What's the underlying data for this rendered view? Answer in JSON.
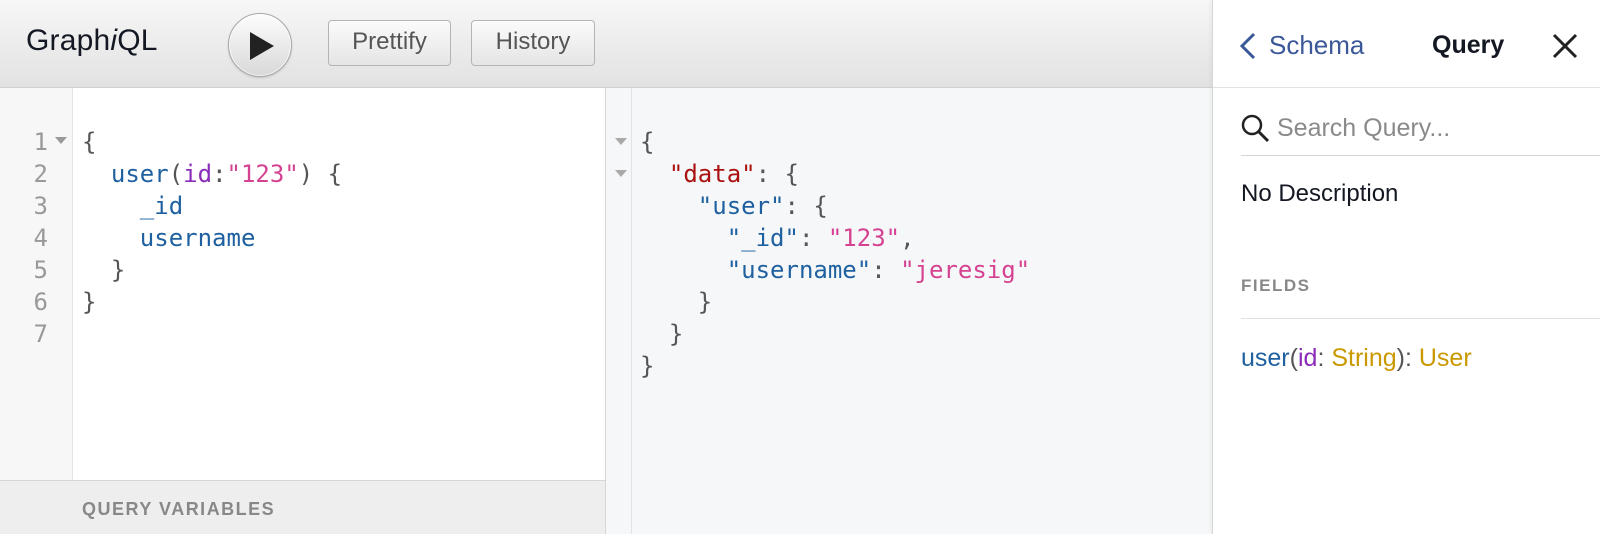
{
  "app": {
    "logo_text": "Graph",
    "logo_italic": "i",
    "logo_suffix": "QL"
  },
  "toolbar": {
    "run_icon": "play-icon",
    "prettify_label": "Prettify",
    "history_label": "History"
  },
  "query_editor": {
    "line_numbers": [
      "1",
      "2",
      "3",
      "4",
      "5",
      "6",
      "7"
    ],
    "lines": [
      [
        {
          "t": "{",
          "c": "punc"
        }
      ],
      [
        {
          "t": "  ",
          "c": "punc"
        },
        {
          "t": "user",
          "c": "field"
        },
        {
          "t": "(",
          "c": "punc"
        },
        {
          "t": "id",
          "c": "arg"
        },
        {
          "t": ":",
          "c": "punc"
        },
        {
          "t": "\"123\"",
          "c": "str"
        },
        {
          "t": ") {",
          "c": "punc"
        }
      ],
      [
        {
          "t": "    ",
          "c": "punc"
        },
        {
          "t": "_id",
          "c": "field"
        }
      ],
      [
        {
          "t": "    ",
          "c": "punc"
        },
        {
          "t": "username",
          "c": "field"
        }
      ],
      [
        {
          "t": "  }",
          "c": "punc"
        }
      ],
      [
        {
          "t": "}",
          "c": "punc"
        }
      ],
      [
        {
          "t": "",
          "c": "punc"
        }
      ]
    ],
    "variables_title": "QUERY VARIABLES"
  },
  "result": {
    "lines": [
      [
        {
          "t": "{",
          "c": "punc"
        }
      ],
      [
        {
          "t": "  ",
          "c": "punc"
        },
        {
          "t": "\"data\"",
          "c": "key"
        },
        {
          "t": ": {",
          "c": "punc"
        }
      ],
      [
        {
          "t": "    ",
          "c": "punc"
        },
        {
          "t": "\"user\"",
          "c": "prop"
        },
        {
          "t": ": {",
          "c": "punc"
        }
      ],
      [
        {
          "t": "      ",
          "c": "punc"
        },
        {
          "t": "\"_id\"",
          "c": "prop"
        },
        {
          "t": ": ",
          "c": "punc"
        },
        {
          "t": "\"123\"",
          "c": "str"
        },
        {
          "t": ",",
          "c": "punc"
        }
      ],
      [
        {
          "t": "      ",
          "c": "punc"
        },
        {
          "t": "\"username\"",
          "c": "prop"
        },
        {
          "t": ": ",
          "c": "punc"
        },
        {
          "t": "\"jeresig\"",
          "c": "str"
        }
      ],
      [
        {
          "t": "    }",
          "c": "punc"
        }
      ],
      [
        {
          "t": "  }",
          "c": "punc"
        }
      ],
      [
        {
          "t": "}",
          "c": "punc"
        }
      ]
    ]
  },
  "docs": {
    "back_label": "Schema",
    "title": "Query",
    "search_placeholder": "Search Query...",
    "description": "No Description",
    "fields_title": "FIELDS",
    "fields": [
      {
        "name": "user",
        "arg_name": "id",
        "arg_type": "String",
        "return_type": "User"
      }
    ]
  },
  "colors": {
    "field": "#1f61a0",
    "argument": "#8b2bb9",
    "string": "#d64292",
    "key": "#aa1111",
    "type": "#ca9800",
    "link": "#3b5998"
  }
}
